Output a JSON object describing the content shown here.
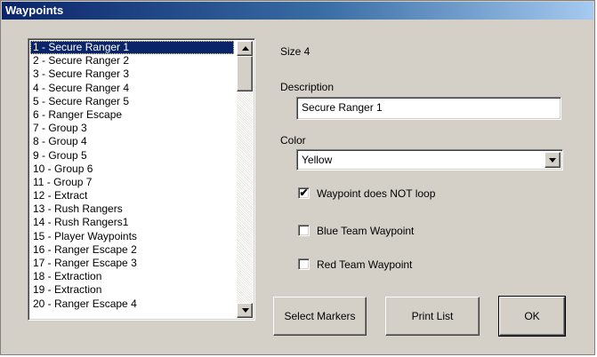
{
  "window": {
    "title": "Waypoints"
  },
  "waypoints": {
    "items": [
      "1 - Secure Ranger 1",
      "2 - Secure Ranger 2",
      "3 - Secure Ranger 3",
      "4 - Secure Ranger 4",
      "5 - Secure Ranger 5",
      "6 - Ranger Escape",
      "7 - Group 3",
      "8 - Group 4",
      "9 - Group 5",
      "10 - Group 6",
      "11 - Group 7",
      "12 - Extract",
      "13 - Rush Rangers",
      "14 - Rush Rangers1",
      "15 - Player Waypoints",
      "16 - Ranger Escape 2",
      "17 - Ranger Escape 3",
      "18 - Extraction",
      "19 - Extraction",
      "20 - Ranger Escape 4"
    ],
    "selected_index": 0
  },
  "details": {
    "size_text": "Size 4",
    "description_label": "Description",
    "description_value": "Secure Ranger 1",
    "color_label": "Color",
    "color_value": "Yellow"
  },
  "options": {
    "no_loop": {
      "label": "Waypoint does NOT loop",
      "checked": true
    },
    "blue_team": {
      "label": "Blue Team Waypoint",
      "checked": false
    },
    "red_team": {
      "label": "Red Team Waypoint",
      "checked": false
    }
  },
  "buttons": {
    "select_markers": "Select Markers",
    "print_list": "Print List",
    "ok": "OK"
  },
  "colors": {
    "title_gradient_start": "#0a246a",
    "title_gradient_end": "#a6caf0",
    "selection": "#0a246a",
    "dialog_face": "#d4d0c8"
  },
  "icons": {
    "scroll_up": "triangle-up",
    "scroll_down": "triangle-down",
    "combo_dropdown": "triangle-down",
    "check": "check-mark"
  }
}
